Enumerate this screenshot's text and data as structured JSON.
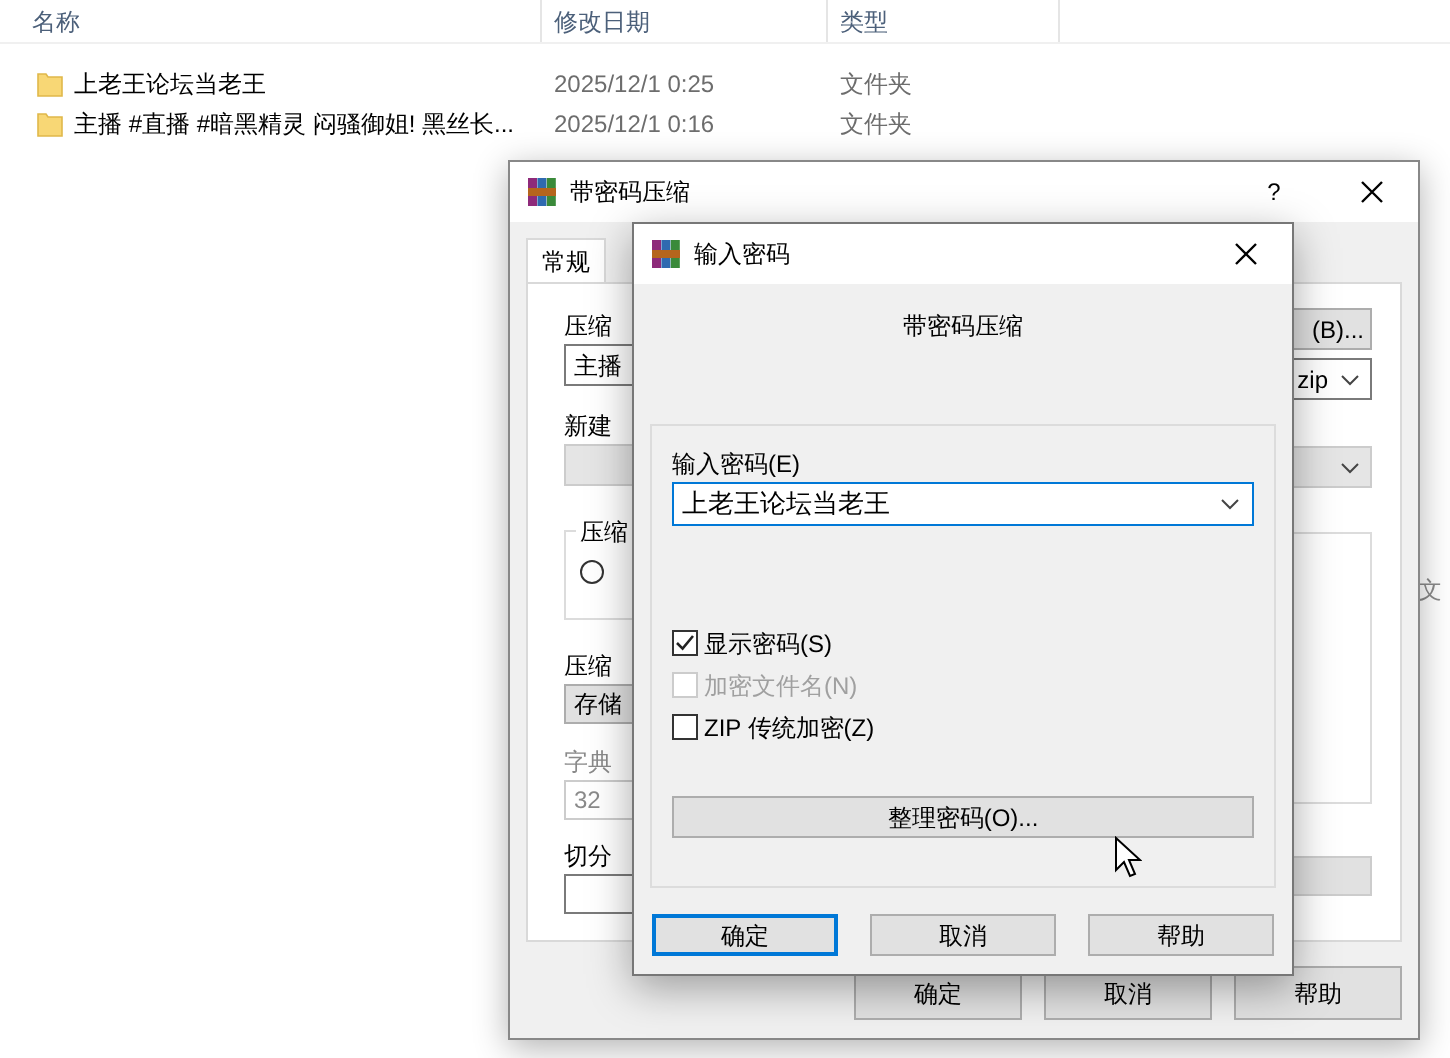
{
  "explorer": {
    "columns": [
      "名称",
      "修改日期",
      "类型"
    ],
    "rows": [
      {
        "name": "上老王论坛当老王",
        "date": "2025/12/1 0:25",
        "type": "文件夹"
      },
      {
        "name": "主播 #直播 #暗黑精灵 闷骚御姐! 黑丝长...",
        "date": "2025/12/1 0:16",
        "type": "文件夹"
      }
    ],
    "side_text": "文"
  },
  "back_dialog": {
    "title": "带密码压缩",
    "help": "?",
    "tabs": [
      {
        "label": "常规",
        "selected": true
      }
    ],
    "left": {
      "archive_label": "压缩",
      "archive_value": "主播",
      "profile_label": "新建",
      "group_label": "压缩",
      "radio_selected": false,
      "method_label": "压缩",
      "method_value": "存储",
      "dict_label": "字典",
      "dict_value": "32",
      "split_label": "切分"
    },
    "right": {
      "browse_button": "(B)...",
      "format_value": "zip"
    },
    "buttons": [
      {
        "label": "确定"
      },
      {
        "label": "取消"
      },
      {
        "label": "帮助"
      }
    ]
  },
  "front_dialog": {
    "title": "输入密码",
    "heading": "带密码压缩",
    "password_label": "输入密码(E)",
    "password_value": "上老王论坛当老王",
    "checkboxes": [
      {
        "label": "显示密码(S)",
        "checked": true,
        "disabled": false
      },
      {
        "label": "加密文件名(N)",
        "checked": false,
        "disabled": true
      },
      {
        "label": "ZIP 传统加密(Z)",
        "checked": false,
        "disabled": false
      }
    ],
    "manage_button": "整理密码(O)...",
    "buttons": [
      {
        "label": "确定",
        "default": true
      },
      {
        "label": "取消",
        "default": false
      },
      {
        "label": "帮助",
        "default": false
      }
    ]
  }
}
